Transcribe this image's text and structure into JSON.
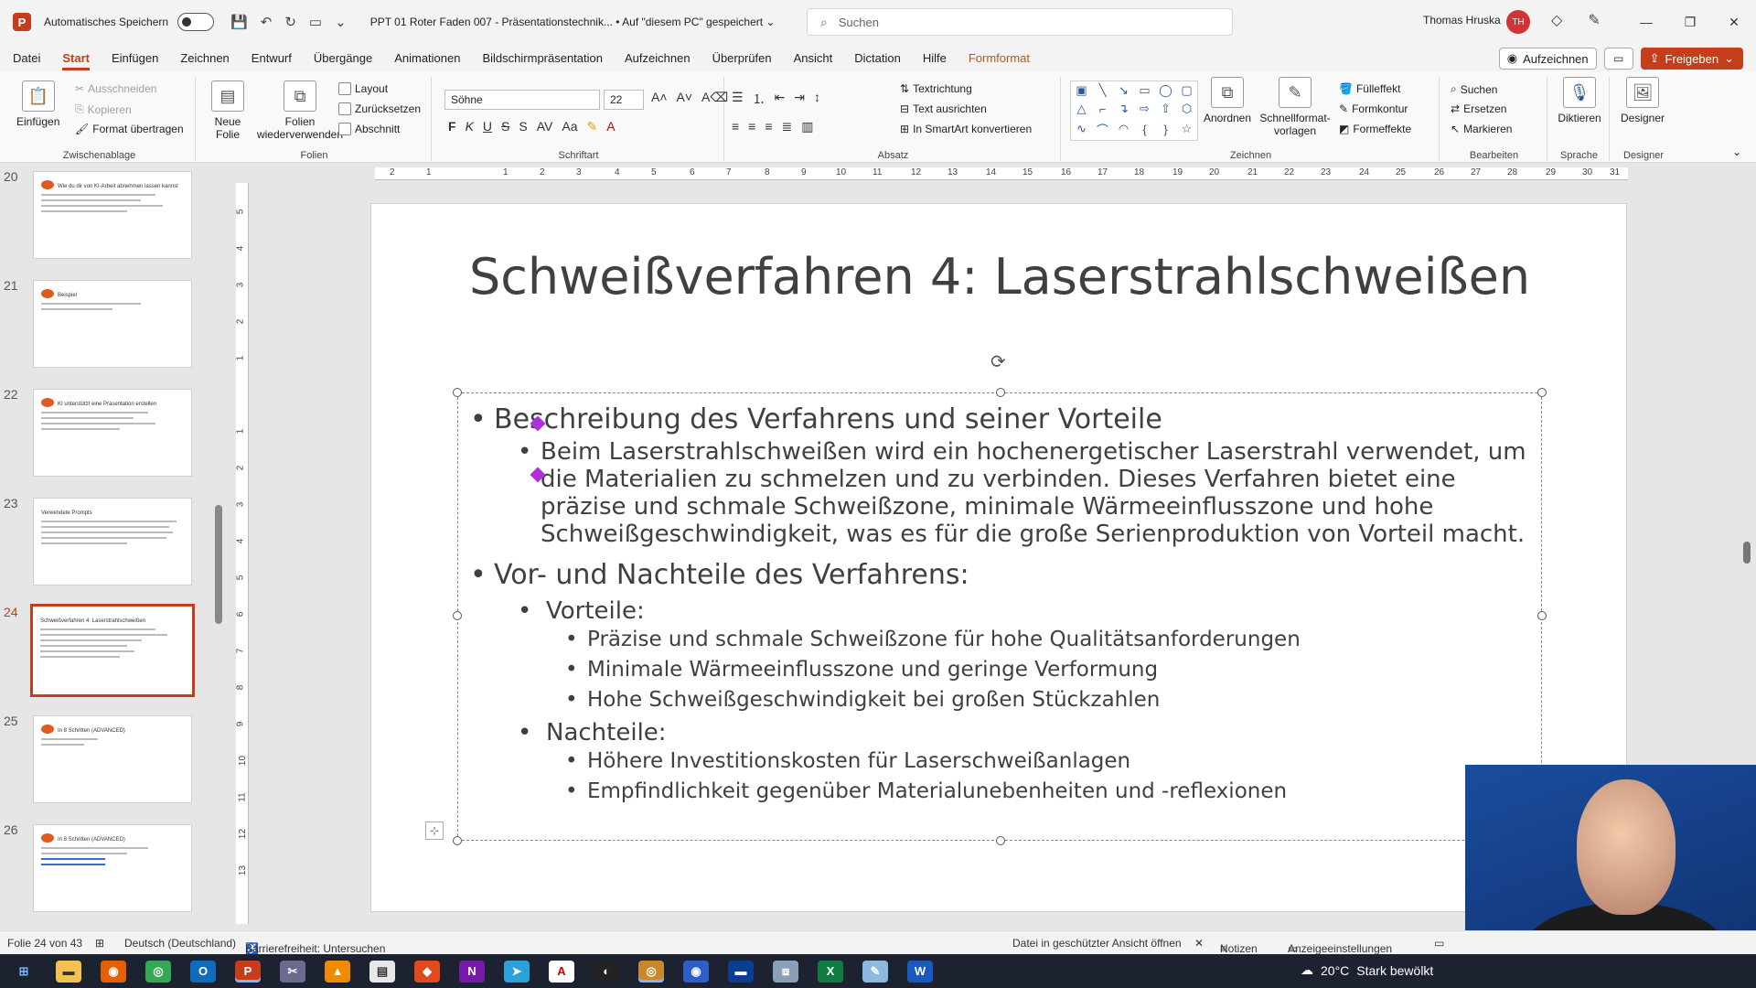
{
  "titlebar": {
    "app_letter": "P",
    "autosave_label": "Automatisches Speichern",
    "doc_title": "PPT 01 Roter Faden 007 - Präsentationstechnik... • Auf \"diesem PC\" gespeichert ⌄",
    "search_placeholder": "Suchen",
    "user_name": "Thomas Hruska",
    "user_initials": "TH"
  },
  "tabs": {
    "items": [
      "Datei",
      "Start",
      "Einfügen",
      "Zeichnen",
      "Entwurf",
      "Übergänge",
      "Animationen",
      "Bildschirmpräsentation",
      "Aufzeichnen",
      "Überprüfen",
      "Ansicht",
      "Dictation",
      "Hilfe",
      "Formformat"
    ],
    "active": "Start",
    "record_label": "Aufzeichnen",
    "share_label": "Freigeben"
  },
  "ribbon": {
    "clipboard": {
      "label": "Zwischenablage",
      "paste": "Einfügen",
      "cut": "Ausschneiden",
      "copy": "Kopieren",
      "format_painter": "Format übertragen"
    },
    "slides": {
      "label": "Folien",
      "new_slide": "Neue Folie",
      "reuse": "Folien wiederverwenden",
      "layout": "Layout",
      "reset": "Zurücksetzen",
      "section": "Abschnitt"
    },
    "font": {
      "label": "Schriftart",
      "font_name": "Söhne",
      "font_size": "22",
      "bold": "F",
      "italic": "K",
      "underline": "U",
      "strike": "S"
    },
    "paragraph": {
      "label": "Absatz",
      "text_direction": "Textrichtung",
      "align_text": "Text ausrichten",
      "smartart": "In SmartArt konvertieren"
    },
    "drawing": {
      "label": "Zeichnen",
      "arrange": "Anordnen",
      "quick_styles": "Schnellformat-vorlagen",
      "fill": "Fülleffekt",
      "outline": "Formkontur",
      "effects": "Formeffekte"
    },
    "editing": {
      "label": "Bearbeiten",
      "find": "Suchen",
      "replace": "Ersetzen",
      "select": "Markieren"
    },
    "voice": {
      "label": "Sprache",
      "dictate": "Diktieren"
    },
    "designer": {
      "label": "Designer",
      "button": "Designer"
    }
  },
  "thumbnails": [
    {
      "num": "20",
      "title": "Wie du dir von KI-Arbeit abnehmen lassen kannst"
    },
    {
      "num": "21",
      "title": "Beispiel"
    },
    {
      "num": "22",
      "title": "KI unterstützt eine Präsentation erstellen"
    },
    {
      "num": "23",
      "title": "Verwendete Prompts"
    },
    {
      "num": "24",
      "title": "Schweißverfahren 4: Laserstrahlschweißen"
    },
    {
      "num": "25",
      "title": "In 8 Schritten (ADVANCED)"
    },
    {
      "num": "26",
      "title": "In 8 Schritten (ADVANCED)"
    }
  ],
  "active_thumbnail": "24",
  "slide": {
    "title": "Schweißverfahren 4: Laserstrahlschweißen",
    "b1": "Beschreibung des Verfahrens und seiner Vorteile",
    "b1_text": "Beim Laserstrahlschweißen wird ein hochenergetischer Laserstrahl verwendet, um die Materialien zu schmelzen und zu verbinden. Dieses Verfahren bietet eine präzise und schmale Schweißzone, minimale Wärmeeinflusszone und hohe Schweißgeschwindigkeit, was es für die große Serienproduktion von Vorteil macht.",
    "b2": "Vor- und Nachteile des Verfahrens:",
    "pros_label": "Vorteile:",
    "pros": [
      "Präzise und schmale Schweißzone für hohe Qualitätsanforderungen",
      "Minimale Wärmeeinflusszone und geringe Verformung",
      "Hohe Schweißgeschwindigkeit bei großen Stückzahlen"
    ],
    "cons_label": "Nachteile:",
    "cons": [
      "Höhere Investitionskosten für Laserschweißanlagen",
      "Empfindlichkeit gegenüber Materialunebenheiten und -reflexionen"
    ]
  },
  "statusbar": {
    "slide_count": "Folie 24 von 43",
    "language": "Deutsch (Deutschland)",
    "accessibility": "Barrierefreiheit: Untersuchen",
    "protected_view": "Datei in geschützter Ansicht öffnen",
    "notes": "Notizen",
    "display_settings": "Anzeigeeinstellungen"
  },
  "taskbar": {
    "weather_temp": "20°C",
    "weather_text": "Stark bewölkt"
  },
  "colors": {
    "accent": "#c43e1c",
    "taskbar": "#1c2230"
  }
}
